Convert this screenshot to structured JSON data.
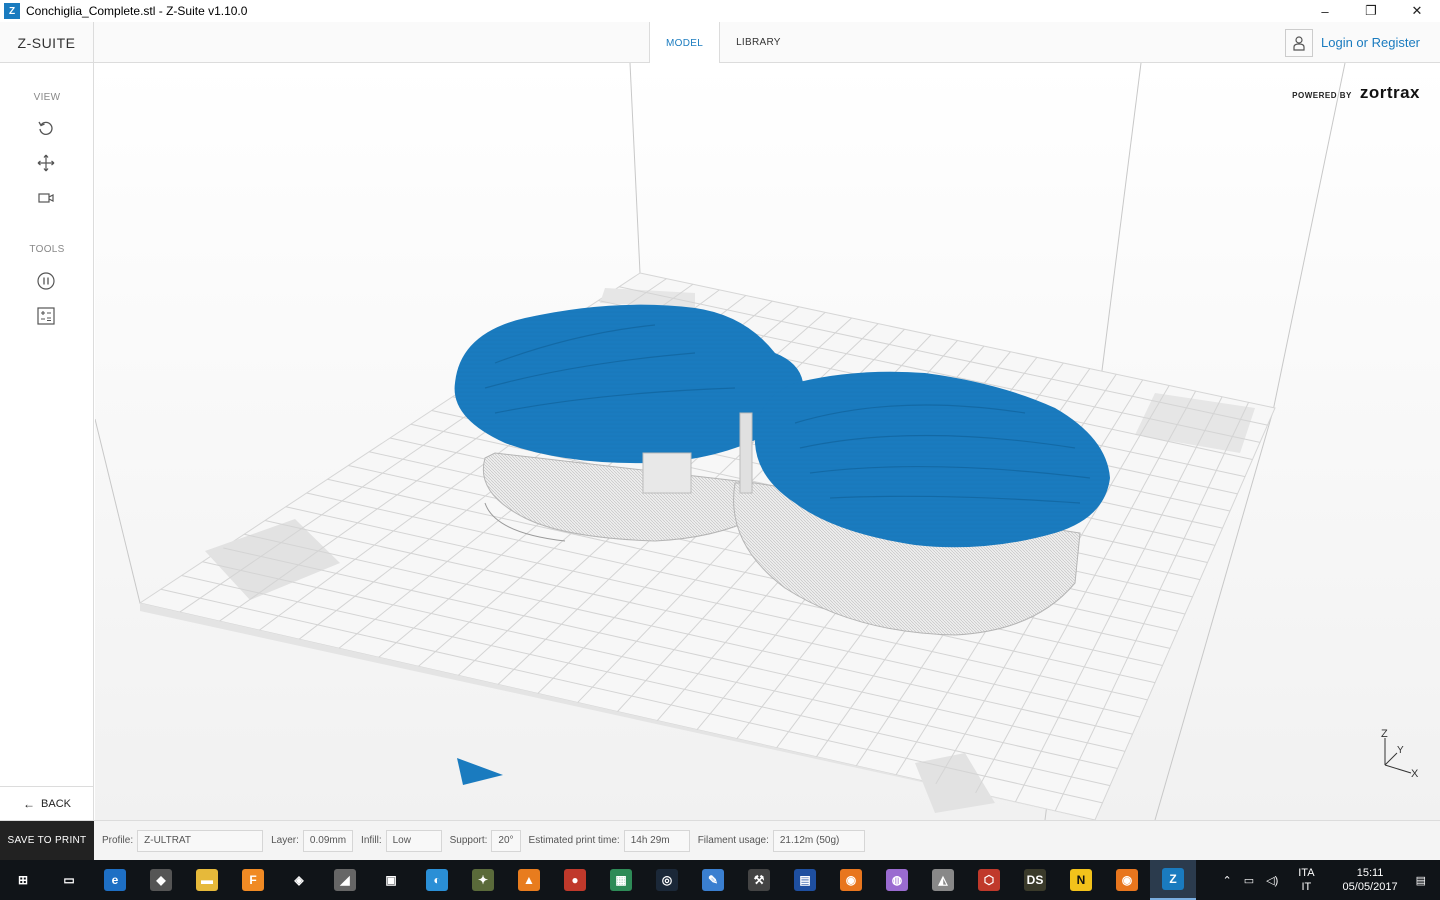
{
  "window": {
    "app_badge": "Z",
    "title": "Conchiglia_Complete.stl - Z-Suite v1.10.0",
    "minimize": "–",
    "restore": "❐",
    "close": "✕"
  },
  "topbar": {
    "logo": "Z-SUITE",
    "tabs": [
      {
        "label": "MODEL",
        "active": true
      },
      {
        "label": "LIBRARY",
        "active": false
      }
    ],
    "login_label": "Login or Register"
  },
  "sidebar": {
    "view_label": "VIEW",
    "tools_label": "TOOLS",
    "view_icons": [
      "rotate-icon",
      "move-icon",
      "camera-icon"
    ],
    "tool_icons": [
      "pause-icon",
      "calculator-icon"
    ],
    "back_label": "BACK"
  },
  "viewport": {
    "powered_by": "POWERED BY",
    "brand": "zortrax",
    "axis_z": "Z",
    "axis_y": "Y",
    "axis_x": "X",
    "model_color": "#1a7bbf"
  },
  "bottombar": {
    "save_label": "SAVE TO PRINT",
    "profile_label": "Profile:",
    "profile_value": "Z-ULTRAT",
    "layer_label": "Layer:",
    "layer_value": "0.09mm",
    "infill_label": "Infill:",
    "infill_value": "Low",
    "support_label": "Support:",
    "support_value": "20°",
    "time_label": "Estimated print time:",
    "time_value": "14h 29m",
    "filament_label": "Filament usage:",
    "filament_value": "21.12m (50g)"
  },
  "taskbar": {
    "apps": [
      {
        "name": "start-icon",
        "glyph": "⊞",
        "color": "#101418"
      },
      {
        "name": "task-view-icon",
        "glyph": "▭",
        "color": "#101418"
      },
      {
        "name": "edge-icon",
        "glyph": "e",
        "color": "#1e6fc4"
      },
      {
        "name": "app-icon",
        "glyph": "◆",
        "color": "#555555"
      },
      {
        "name": "explorer-icon",
        "glyph": "▬",
        "color": "#e6b93a"
      },
      {
        "name": "fusion-icon",
        "glyph": "F",
        "color": "#f08a24"
      },
      {
        "name": "unity-icon",
        "glyph": "◈",
        "color": "#101418"
      },
      {
        "name": "app-icon",
        "glyph": "◢",
        "color": "#666666"
      },
      {
        "name": "store-icon",
        "glyph": "▣",
        "color": "#101418"
      },
      {
        "name": "app-icon",
        "glyph": "◐",
        "color": "#2a8fd6"
      },
      {
        "name": "app-icon",
        "glyph": "✦",
        "color": "#5a6a3a"
      },
      {
        "name": "vlc-icon",
        "glyph": "▲",
        "color": "#e87c1e"
      },
      {
        "name": "app-icon",
        "glyph": "●",
        "color": "#c0392b"
      },
      {
        "name": "app-icon",
        "glyph": "▦",
        "color": "#2e8b57"
      },
      {
        "name": "steam-icon",
        "glyph": "◎",
        "color": "#1b2838"
      },
      {
        "name": "paint-icon",
        "glyph": "✎",
        "color": "#3a7fd0"
      },
      {
        "name": "app-icon",
        "glyph": "⚒",
        "color": "#444444"
      },
      {
        "name": "app-icon",
        "glyph": "▤",
        "color": "#1e4fa0"
      },
      {
        "name": "blender-icon",
        "glyph": "◉",
        "color": "#e8761e"
      },
      {
        "name": "app-icon",
        "glyph": "◍",
        "color": "#9a6bd0"
      },
      {
        "name": "app-icon",
        "glyph": "◭",
        "color": "#888888"
      },
      {
        "name": "app-icon",
        "glyph": "⬡",
        "color": "#c0392b"
      },
      {
        "name": "ds-icon",
        "glyph": "DS",
        "color": "#3a3a2a"
      },
      {
        "name": "n-icon",
        "glyph": "N",
        "color": "#f2c21b"
      },
      {
        "name": "blender-icon",
        "glyph": "◉",
        "color": "#e8761e"
      },
      {
        "name": "zsuite-icon",
        "glyph": "Z",
        "color": "#1a7bbf"
      }
    ],
    "lang_top": "ITA",
    "lang_bottom": "IT",
    "time": "15:11",
    "date": "05/05/2017"
  }
}
